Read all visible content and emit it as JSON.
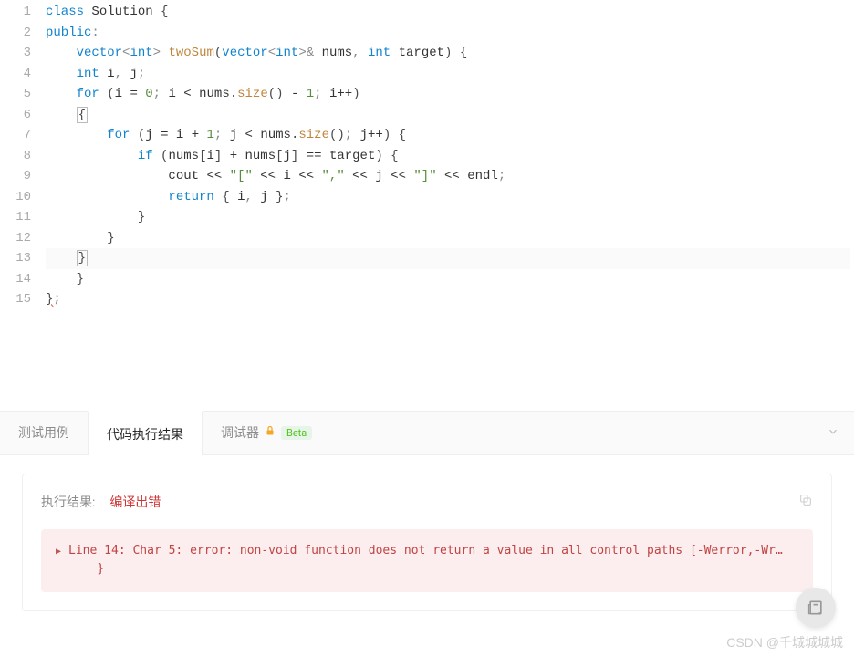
{
  "code": {
    "lines": [
      {
        "n": 1,
        "tokens": [
          [
            "kw",
            "class"
          ],
          [
            "plain",
            " "
          ],
          [
            "id",
            "Solution"
          ],
          [
            "plain",
            " {"
          ]
        ]
      },
      {
        "n": 2,
        "tokens": [
          [
            "kw",
            "public"
          ],
          [
            "gray",
            ":"
          ]
        ]
      },
      {
        "n": 3,
        "tokens": [
          [
            "plain",
            "    "
          ],
          [
            "type",
            "vector"
          ],
          [
            "gray",
            "<"
          ],
          [
            "kw",
            "int"
          ],
          [
            "gray",
            ">"
          ],
          [
            "plain",
            " "
          ],
          [
            "fn",
            "twoSum"
          ],
          [
            "plain",
            "("
          ],
          [
            "type",
            "vector"
          ],
          [
            "gray",
            "<"
          ],
          [
            "kw",
            "int"
          ],
          [
            "gray",
            ">&"
          ],
          [
            "plain",
            " "
          ],
          [
            "id",
            "nums"
          ],
          [
            "gray",
            ","
          ],
          [
            "plain",
            " "
          ],
          [
            "kw",
            "int"
          ],
          [
            "plain",
            " "
          ],
          [
            "id",
            "target"
          ],
          [
            "plain",
            ") {"
          ]
        ]
      },
      {
        "n": 4,
        "tokens": [
          [
            "plain",
            "    "
          ],
          [
            "kw",
            "int"
          ],
          [
            "plain",
            " "
          ],
          [
            "id",
            "i"
          ],
          [
            "gray",
            ","
          ],
          [
            "plain",
            " "
          ],
          [
            "id",
            "j"
          ],
          [
            "gray",
            ";"
          ]
        ]
      },
      {
        "n": 5,
        "tokens": [
          [
            "plain",
            "    "
          ],
          [
            "kw",
            "for"
          ],
          [
            "plain",
            " ("
          ],
          [
            "id",
            "i"
          ],
          [
            "plain",
            " "
          ],
          [
            "op",
            "="
          ],
          [
            "plain",
            " "
          ],
          [
            "num",
            "0"
          ],
          [
            "gray",
            ";"
          ],
          [
            "plain",
            " "
          ],
          [
            "id",
            "i"
          ],
          [
            "plain",
            " "
          ],
          [
            "op",
            "<"
          ],
          [
            "plain",
            " "
          ],
          [
            "id",
            "nums"
          ],
          [
            "plain",
            "."
          ],
          [
            "fn",
            "size"
          ],
          [
            "plain",
            "() "
          ],
          [
            "op",
            "-"
          ],
          [
            "plain",
            " "
          ],
          [
            "num",
            "1"
          ],
          [
            "gray",
            ";"
          ],
          [
            "plain",
            " "
          ],
          [
            "id",
            "i"
          ],
          [
            "op",
            "++"
          ],
          [
            "plain",
            ")"
          ]
        ]
      },
      {
        "n": 6,
        "tokens": [
          [
            "plain",
            "    "
          ],
          [
            "bracket",
            "{"
          ]
        ]
      },
      {
        "n": 7,
        "tokens": [
          [
            "plain",
            "        "
          ],
          [
            "kw",
            "for"
          ],
          [
            "plain",
            " ("
          ],
          [
            "id",
            "j"
          ],
          [
            "plain",
            " "
          ],
          [
            "op",
            "="
          ],
          [
            "plain",
            " "
          ],
          [
            "id",
            "i"
          ],
          [
            "plain",
            " "
          ],
          [
            "op",
            "+"
          ],
          [
            "plain",
            " "
          ],
          [
            "num",
            "1"
          ],
          [
            "gray",
            ";"
          ],
          [
            "plain",
            " "
          ],
          [
            "id",
            "j"
          ],
          [
            "plain",
            " "
          ],
          [
            "op",
            "<"
          ],
          [
            "plain",
            " "
          ],
          [
            "id",
            "nums"
          ],
          [
            "plain",
            "."
          ],
          [
            "fn",
            "size"
          ],
          [
            "plain",
            "()"
          ],
          [
            "gray",
            ";"
          ],
          [
            "plain",
            " "
          ],
          [
            "id",
            "j"
          ],
          [
            "op",
            "++"
          ],
          [
            "plain",
            ") {"
          ]
        ]
      },
      {
        "n": 8,
        "tokens": [
          [
            "plain",
            "            "
          ],
          [
            "kw",
            "if"
          ],
          [
            "plain",
            " ("
          ],
          [
            "id",
            "nums"
          ],
          [
            "plain",
            "["
          ],
          [
            "id",
            "i"
          ],
          [
            "plain",
            "] "
          ],
          [
            "op",
            "+"
          ],
          [
            "plain",
            " "
          ],
          [
            "id",
            "nums"
          ],
          [
            "plain",
            "["
          ],
          [
            "id",
            "j"
          ],
          [
            "plain",
            "] "
          ],
          [
            "op",
            "=="
          ],
          [
            "plain",
            " "
          ],
          [
            "id",
            "target"
          ],
          [
            "plain",
            ") {"
          ]
        ]
      },
      {
        "n": 9,
        "tokens": [
          [
            "plain",
            "                "
          ],
          [
            "id",
            "cout"
          ],
          [
            "plain",
            " "
          ],
          [
            "op",
            "<<"
          ],
          [
            "plain",
            " "
          ],
          [
            "str",
            "\"[\""
          ],
          [
            "plain",
            " "
          ],
          [
            "op",
            "<<"
          ],
          [
            "plain",
            " "
          ],
          [
            "id",
            "i"
          ],
          [
            "plain",
            " "
          ],
          [
            "op",
            "<<"
          ],
          [
            "plain",
            " "
          ],
          [
            "str",
            "\",\""
          ],
          [
            "plain",
            " "
          ],
          [
            "op",
            "<<"
          ],
          [
            "plain",
            " "
          ],
          [
            "id",
            "j"
          ],
          [
            "plain",
            " "
          ],
          [
            "op",
            "<<"
          ],
          [
            "plain",
            " "
          ],
          [
            "str",
            "\"]\""
          ],
          [
            "plain",
            " "
          ],
          [
            "op",
            "<<"
          ],
          [
            "plain",
            " "
          ],
          [
            "id",
            "endl"
          ],
          [
            "gray",
            ";"
          ]
        ]
      },
      {
        "n": 10,
        "tokens": [
          [
            "plain",
            "                "
          ],
          [
            "kw",
            "return"
          ],
          [
            "plain",
            " { "
          ],
          [
            "id",
            "i"
          ],
          [
            "gray",
            ","
          ],
          [
            "plain",
            " "
          ],
          [
            "id",
            "j"
          ],
          [
            "plain",
            " }"
          ],
          [
            "gray",
            ";"
          ]
        ]
      },
      {
        "n": 11,
        "tokens": [
          [
            "plain",
            "            }"
          ]
        ]
      },
      {
        "n": 12,
        "tokens": [
          [
            "plain",
            "        }"
          ]
        ]
      },
      {
        "n": 13,
        "highlighted": true,
        "tokens": [
          [
            "plain",
            "    "
          ],
          [
            "bracket",
            "}"
          ]
        ]
      },
      {
        "n": 14,
        "tokens": [
          [
            "plain",
            "    }"
          ]
        ]
      },
      {
        "n": 15,
        "squiggle": true,
        "tokens": [
          [
            "plain",
            "}"
          ],
          [
            "gray",
            ";"
          ]
        ]
      }
    ]
  },
  "tabs": {
    "items": [
      {
        "label": "测试用例",
        "active": false
      },
      {
        "label": "代码执行结果",
        "active": true
      },
      {
        "label": "调试器",
        "active": false,
        "lock": true,
        "beta": "Beta"
      }
    ]
  },
  "result": {
    "label": "执行结果:",
    "status": "编译出错",
    "error": "Line 14: Char 5: error: non-void function does not return a value in all control paths [-Werror,-Wr…\n    }"
  },
  "watermark": "CSDN @千城城城城"
}
